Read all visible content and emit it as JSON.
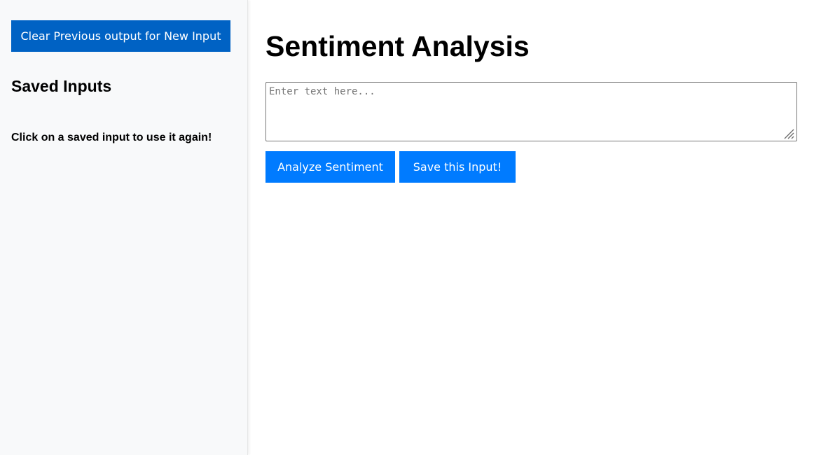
{
  "sidebar": {
    "clear_button_label": "Clear Previous output for New Input",
    "saved_heading": "Saved Inputs",
    "saved_hint": "Click on a saved input to use it again!"
  },
  "main": {
    "title": "Sentiment Analysis",
    "text_input": {
      "value": "",
      "placeholder": "Enter text here..."
    },
    "analyze_button_label": "Analyze Sentiment",
    "save_button_label": "Save this Input!"
  },
  "colors": {
    "sidebar_background": "#f8f9fa",
    "clear_button": "#0062c4",
    "primary_button": "#007bff",
    "button_text": "#ffffff"
  },
  "icons": {
    "textarea_resize": "resize-grip-icon"
  }
}
